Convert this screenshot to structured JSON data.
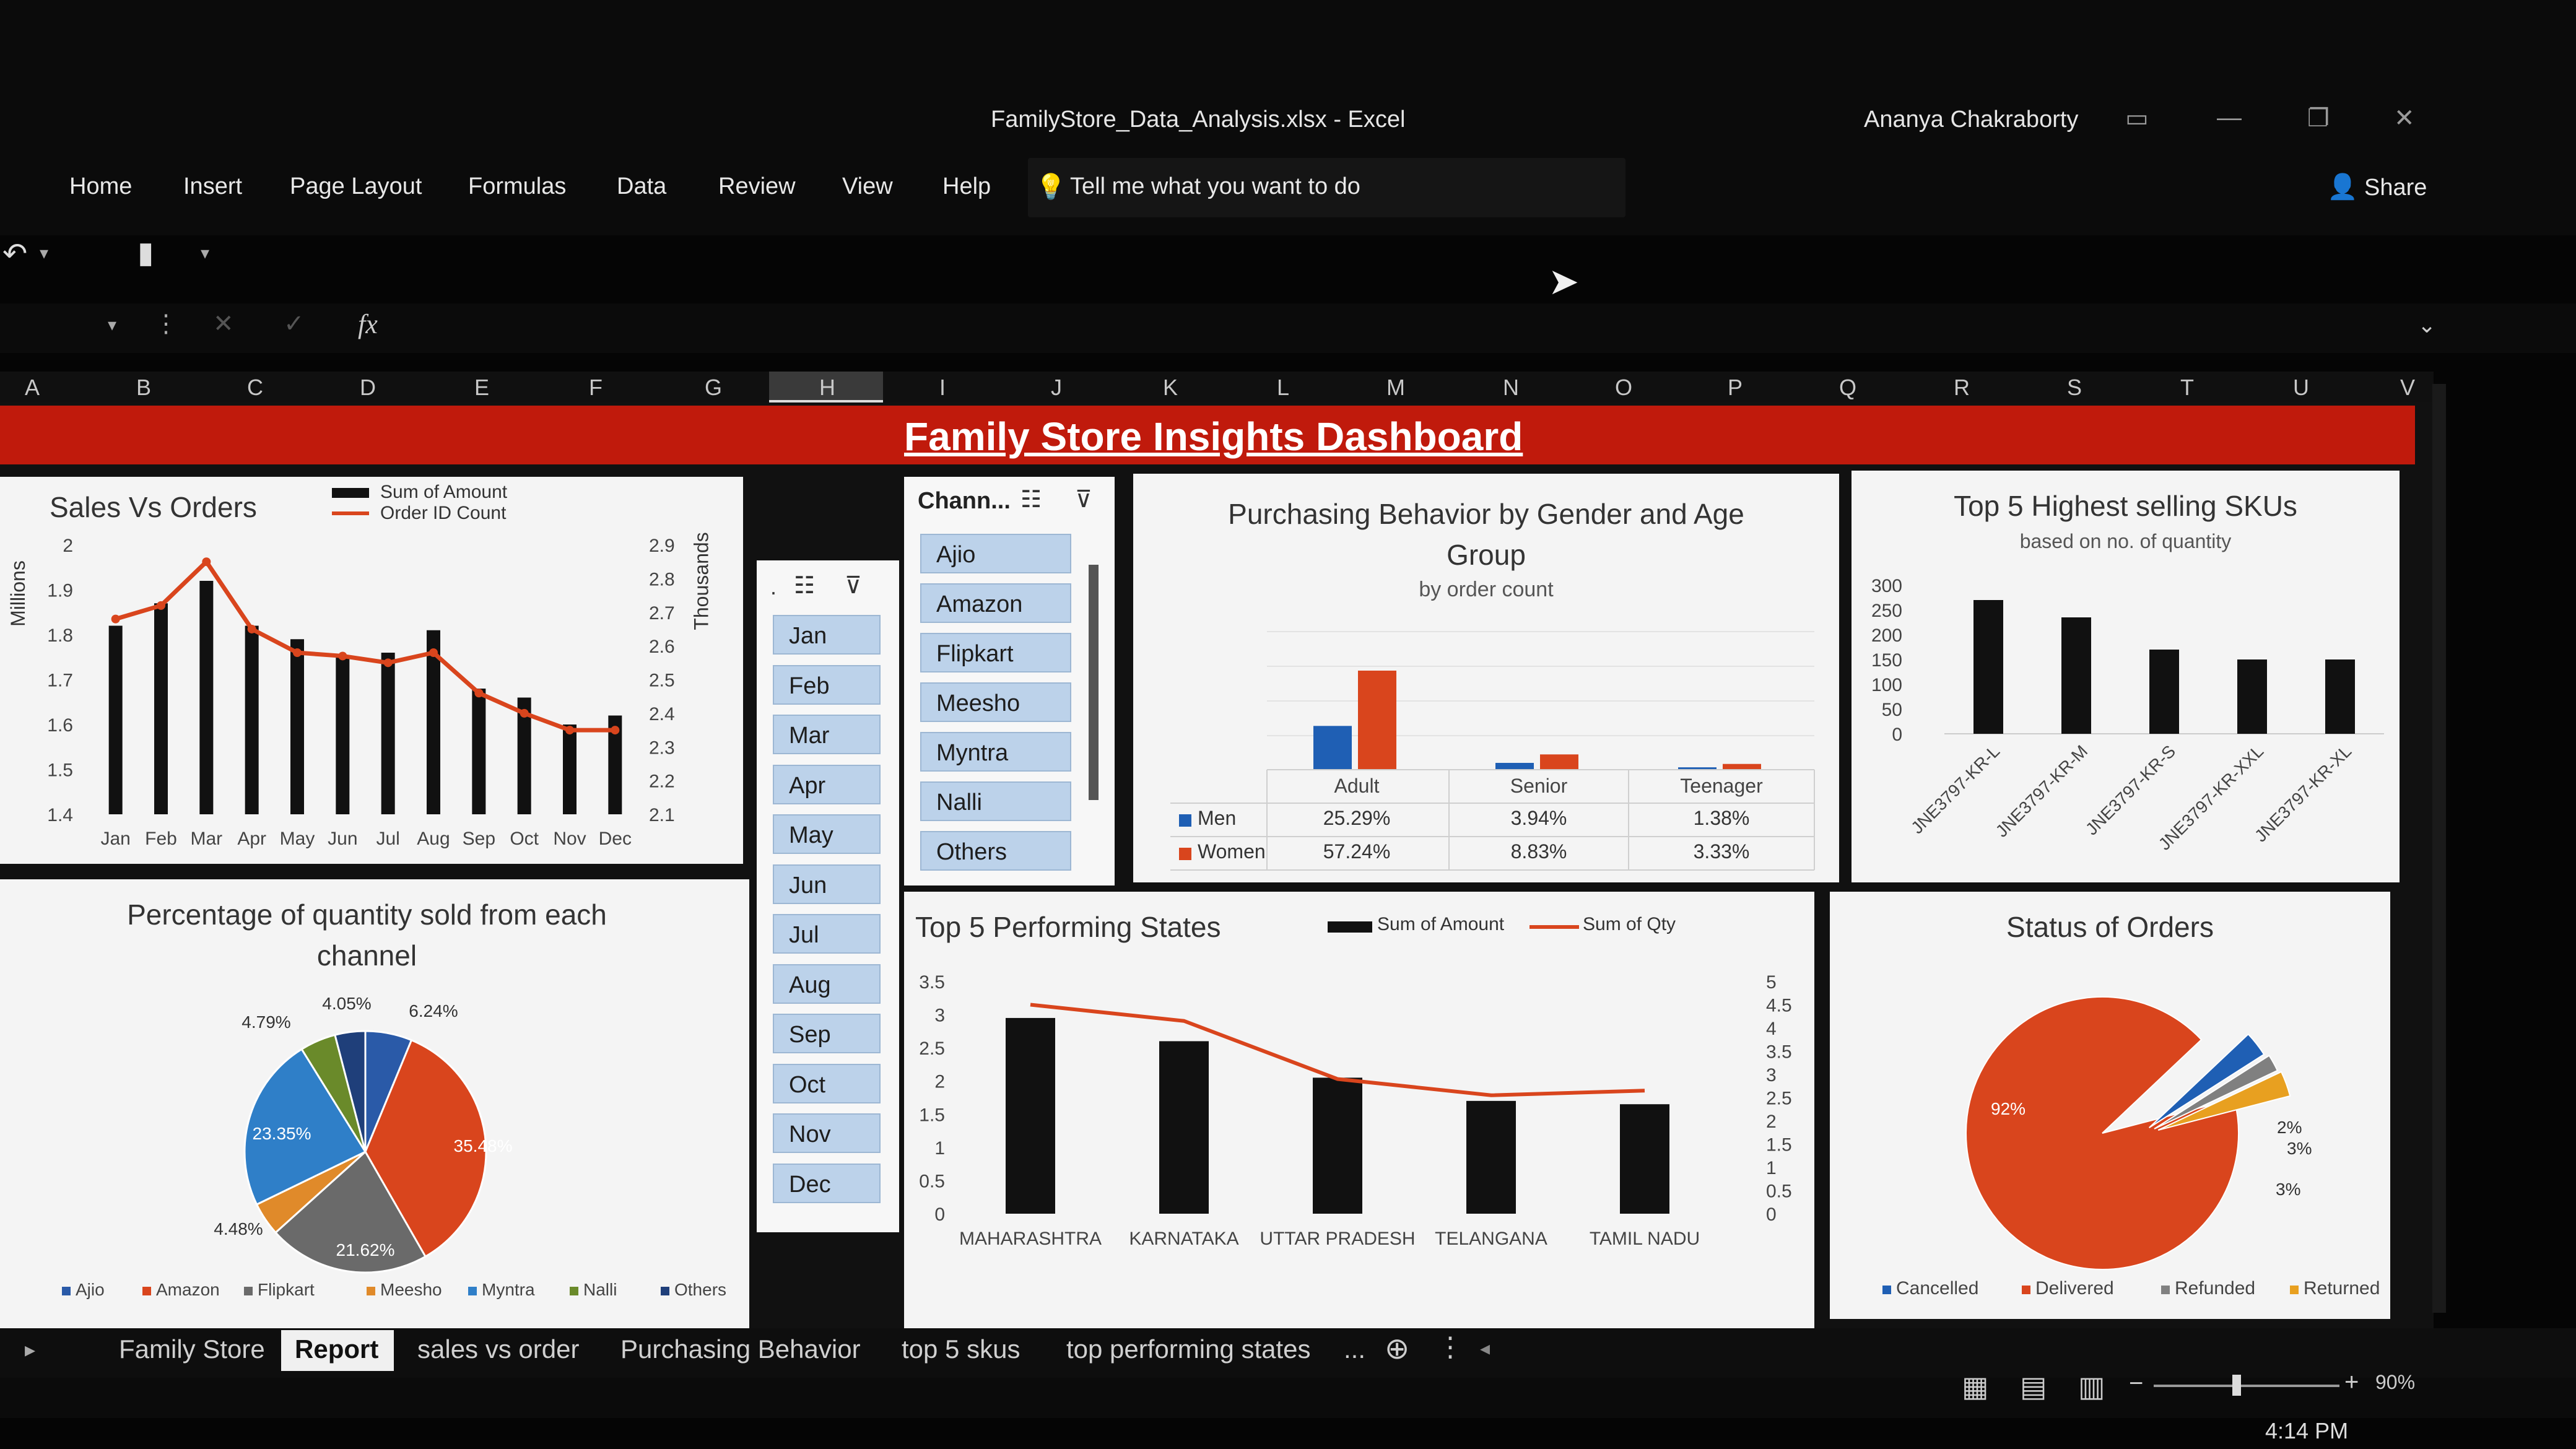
{
  "window": {
    "file_name": "FamilyStore_Data_Analysis.xlsx",
    "app_name": "Excel",
    "separator": "-",
    "user": "Ananya Chakraborty",
    "share_label": "Share"
  },
  "ribbon": {
    "tabs": [
      "Home",
      "Insert",
      "Page Layout",
      "Formulas",
      "Data",
      "Review",
      "View",
      "Help"
    ],
    "tell_me": "Tell me what you want to do"
  },
  "formula_bar": {
    "fx": "fx"
  },
  "columns": [
    "A",
    "B",
    "C",
    "D",
    "E",
    "F",
    "G",
    "H",
    "I",
    "J",
    "K",
    "L",
    "M",
    "N",
    "O",
    "P",
    "Q",
    "R",
    "S",
    "T",
    "U",
    "V"
  ],
  "dashboard": {
    "title": "Family Store Insights Dashboard"
  },
  "sales_vs_orders": {
    "title": "Sales Vs Orders",
    "legend": [
      "Sum of Amount",
      "Order ID Count"
    ],
    "left_axis_label": "Millions",
    "right_axis_label": "Thousands",
    "left_ticks": [
      "2",
      "1.9",
      "1.8",
      "1.7",
      "1.6",
      "1.5",
      "1.4"
    ],
    "right_ticks": [
      "2.9",
      "2.8",
      "2.7",
      "2.6",
      "2.5",
      "2.4",
      "2.3",
      "2.2",
      "2.1"
    ],
    "colors": {
      "bar": "#111111",
      "line": "#d9451d"
    }
  },
  "month_slicer": {
    "months": [
      "Jan",
      "Feb",
      "Mar",
      "Apr",
      "May",
      "Jun",
      "Jul",
      "Aug",
      "Sep",
      "Oct",
      "Nov",
      "Dec"
    ]
  },
  "channel_slicer": {
    "title": "Chann...",
    "channels": [
      "Ajio",
      "Amazon",
      "Flipkart",
      "Meesho",
      "Myntra",
      "Nalli",
      "Others"
    ]
  },
  "purchasing": {
    "title_line1": "Purchasing Behavior by Gender and Age",
    "title_line2": "Group",
    "subtitle": "by order count",
    "groups": [
      "Adult",
      "Senior",
      "Teenager"
    ],
    "rows": [
      {
        "label": "Men",
        "values": [
          "25.29%",
          "3.94%",
          "1.38%"
        ]
      },
      {
        "label": "Women",
        "values": [
          "57.24%",
          "8.83%",
          "3.33%"
        ]
      }
    ],
    "colors": {
      "men": "#1f5fb4",
      "women": "#d9451d"
    }
  },
  "top_skus": {
    "title": "Top 5 Highest selling SKUs",
    "subtitle": "based on no. of quantity",
    "ticks": [
      "300",
      "250",
      "200",
      "150",
      "100",
      "50",
      "0"
    ]
  },
  "pie_channel": {
    "title_line1": "Percentage of quantity sold from each",
    "title_line2": "channel",
    "legend": [
      "Ajio",
      "Amazon",
      "Flipkart",
      "Meesho",
      "Myntra",
      "Nalli",
      "Others"
    ],
    "colors": [
      "#2a5aa8",
      "#d9451d",
      "#6a6a6a",
      "#e08a2a",
      "#2f7fc8",
      "#6a8a2a",
      "#1f3f7a"
    ]
  },
  "top_states": {
    "title": "Top 5 Performing States",
    "legend": [
      "Sum of Amount",
      "Sum of Qty"
    ],
    "left_ticks": [
      "3.5",
      "3",
      "2.5",
      "2",
      "1.5",
      "1",
      "0.5",
      "0"
    ],
    "right_ticks": [
      "5",
      "4.5",
      "4",
      "3.5",
      "3",
      "2.5",
      "2",
      "1.5",
      "1",
      "0.5",
      "0"
    ]
  },
  "order_status": {
    "title": "Status of Orders",
    "legend": [
      "Cancelled",
      "Delivered",
      "Refunded",
      "Returned"
    ],
    "colors": [
      "#1f5fb4",
      "#d9451d",
      "#808080",
      "#e8a020"
    ]
  },
  "chart_data": [
    {
      "type": "bar",
      "title": "Sales Vs Orders",
      "categories": [
        "Jan",
        "Feb",
        "Mar",
        "Apr",
        "May",
        "Jun",
        "Jul",
        "Aug",
        "Sep",
        "Oct",
        "Nov",
        "Dec"
      ],
      "series": [
        {
          "name": "Sum of Amount",
          "axis": "left",
          "values": [
            1.82,
            1.87,
            1.92,
            1.82,
            1.79,
            1.75,
            1.76,
            1.81,
            1.68,
            1.66,
            1.6,
            1.62
          ]
        },
        {
          "name": "Order ID Count",
          "type": "line",
          "axis": "right",
          "values": [
            2.68,
            2.72,
            2.85,
            2.65,
            2.58,
            2.57,
            2.55,
            2.58,
            2.46,
            2.4,
            2.35,
            2.35
          ]
        }
      ],
      "ylabel": "Millions",
      "ylim": [
        1.4,
        2.0
      ],
      "y2label": "Thousands",
      "y2lim": [
        2.1,
        2.9
      ]
    },
    {
      "type": "bar",
      "title": "Purchasing Behavior by Gender and Age Group",
      "categories": [
        "Adult",
        "Senior",
        "Teenager"
      ],
      "series": [
        {
          "name": "Men",
          "values": [
            25.29,
            3.94,
            1.38
          ]
        },
        {
          "name": "Women",
          "values": [
            57.24,
            8.83,
            3.33
          ]
        }
      ]
    },
    {
      "type": "bar",
      "title": "Top 5 Highest selling SKUs",
      "categories": [
        "JNE3797-KR-L",
        "JNE3797-KR-M",
        "JNE3797-KR-S",
        "JNE3797-KR-XXL",
        "JNE3797-KR-XL"
      ],
      "values": [
        270,
        235,
        170,
        150,
        150
      ],
      "ylim": [
        0,
        300
      ]
    },
    {
      "type": "pie",
      "title": "Percentage of quantity sold from each channel",
      "labels": [
        "Ajio",
        "Amazon",
        "Flipkart",
        "Meesho",
        "Myntra",
        "Nalli",
        "Others"
      ],
      "values": [
        6.24,
        35.48,
        21.62,
        4.48,
        23.35,
        4.79,
        4.05
      ],
      "value_labels": [
        "6.24%",
        "35.48%",
        "21.62%",
        "4.48%",
        "23.35%",
        "4.79%",
        "4.05%"
      ]
    },
    {
      "type": "bar",
      "title": "Top 5 Performing States",
      "categories": [
        "MAHARASHTRA",
        "KARNATAKA",
        "UTTAR PRADESH",
        "TELANGANA",
        "TAMIL NADU"
      ],
      "series": [
        {
          "name": "Sum of Amount",
          "axis": "left",
          "values": [
            2.95,
            2.6,
            2.05,
            1.7,
            1.65
          ]
        },
        {
          "name": "Sum of Qty",
          "type": "line",
          "axis": "right",
          "values": [
            4.5,
            4.15,
            2.9,
            2.55,
            2.65
          ]
        }
      ],
      "ylim": [
        0,
        3.5
      ],
      "y2lim": [
        0,
        5
      ]
    },
    {
      "type": "pie",
      "title": "Status of Orders",
      "labels": [
        "Delivered",
        "Cancelled",
        "Refunded",
        "Returned"
      ],
      "values": [
        92,
        3,
        2,
        3
      ],
      "value_labels": [
        "92%",
        "3%",
        "2%",
        "3%"
      ]
    }
  ],
  "sheet_tabs": [
    "Family Store",
    "Report",
    "sales vs order",
    "Purchasing Behavior",
    "top 5 skus",
    "top performing states",
    "..."
  ],
  "active_sheet": "Report",
  "status": {
    "zoom": "90%",
    "time": "4:14 PM"
  }
}
